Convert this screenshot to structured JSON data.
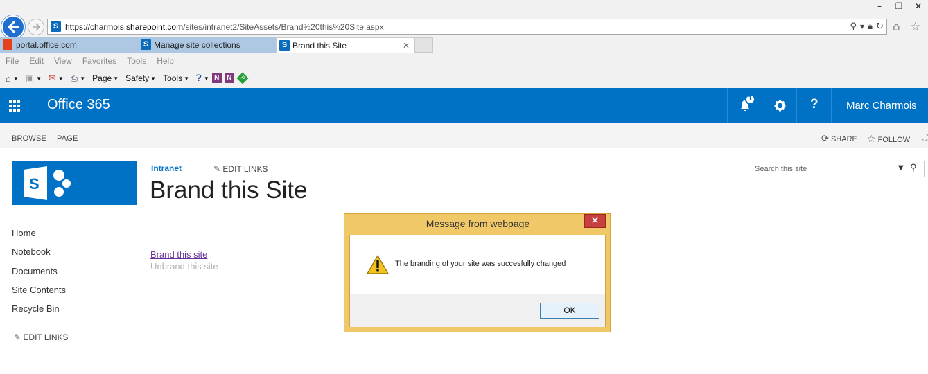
{
  "browser": {
    "url_prefix": "https://charmois.",
    "url_domain": "sharepoint.com",
    "url_path": "/sites/intranet2/SiteAssets/Brand%20this%20Site.aspx",
    "window_controls": [
      "–",
      "❐",
      "✕"
    ],
    "tabs": [
      {
        "label": "portal.office.com"
      },
      {
        "label": "Manage site collections"
      },
      {
        "label": "Brand this Site",
        "close": "✕"
      }
    ],
    "menu": [
      "File",
      "Edit",
      "View",
      "Favorites",
      "Tools",
      "Help"
    ],
    "commands": {
      "page": "Page",
      "safety": "Safety",
      "tools": "Tools"
    }
  },
  "suite_bar": {
    "brand": "Office 365",
    "notification_count": "1",
    "user_name": "Marc Charmois",
    "color": "#0072c6"
  },
  "ribbon": {
    "tabs": [
      "BROWSE",
      "PAGE"
    ],
    "share": "SHARE",
    "follow": "FOLLOW"
  },
  "site": {
    "site_title": "Intranet",
    "edit_links": "EDIT LINKS",
    "page_title": "Brand this Site",
    "search_placeholder": "Search this site"
  },
  "quick_launch": [
    "Home",
    "Notebook",
    "Documents",
    "Site Contents",
    "Recycle Bin"
  ],
  "content": {
    "brand_link": "Brand this site",
    "unbrand_link": "Unbrand this site"
  },
  "dialog": {
    "title": "Message from webpage",
    "message": "The branding of your site was succesfully changed",
    "ok": "OK",
    "close": "✕"
  }
}
